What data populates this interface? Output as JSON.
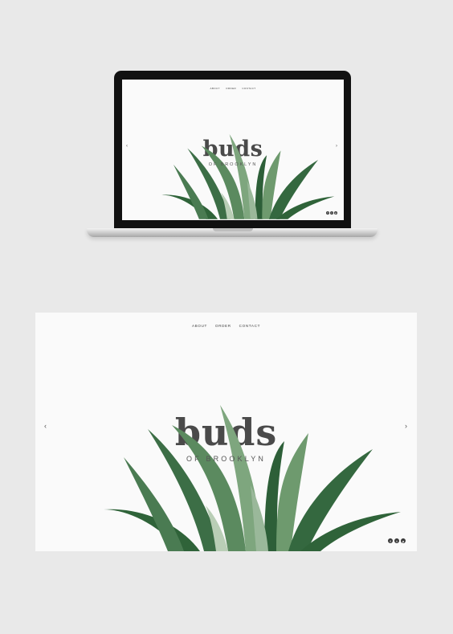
{
  "site": {
    "nav": [
      "ABOUT",
      "ORDER",
      "CONTACT"
    ],
    "brand": "buds",
    "tagline": "OF BROOKLYN",
    "prev_arrow": "‹",
    "next_arrow": "›",
    "social": [
      {
        "name": "facebook-icon",
        "glyph": "f"
      },
      {
        "name": "twitter-icon",
        "glyph": "t"
      },
      {
        "name": "pinterest-icon",
        "glyph": "p"
      }
    ]
  },
  "colors": {
    "background": "#e9e9e9",
    "page": "#fafafa",
    "text": "#4a4a4a",
    "leaf_dark": "#2f6339",
    "leaf_light": "#6e9a6e",
    "social": "#3a3a3a"
  }
}
